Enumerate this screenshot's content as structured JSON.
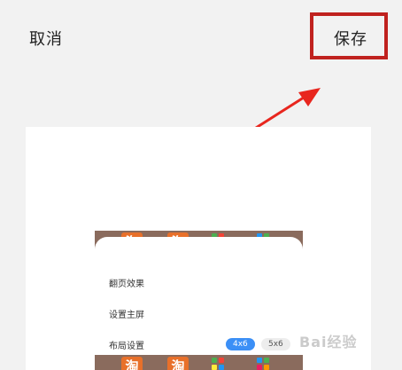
{
  "header": {
    "cancel_label": "取消",
    "save_label": "保存"
  },
  "annotation": {
    "highlight_color": "#c0221f",
    "arrow_color": "#e8261e"
  },
  "preview": {
    "app_icon_glyph": "淘",
    "menu": {
      "page_effect": "翻页效果",
      "set_home": "设置主屏",
      "layout_setting": "布局设置"
    },
    "layout_options": [
      "4x6",
      "5x6"
    ],
    "selected_layout": "4x6",
    "accent_color": "#3b8ff6"
  },
  "watermark": "Bai经验"
}
